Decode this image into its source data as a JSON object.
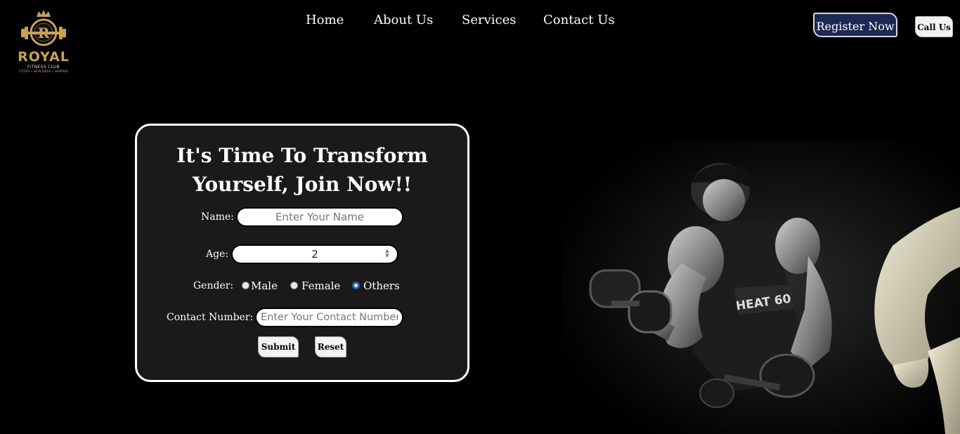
{
  "brand": {
    "name": "ROYAL",
    "subtitle": "FITNESS CLUB",
    "tagline": "FITTER • HEALTHIER • HAPPIER",
    "logo_icon": "crown-dumbbell-emblem",
    "gold_color": "#c9a24a"
  },
  "nav": {
    "items": [
      {
        "label": "Home"
      },
      {
        "label": "About Us"
      },
      {
        "label": "Services"
      },
      {
        "label": "Contact Us"
      }
    ],
    "register_label": "Register Now",
    "call_label": "Call Us",
    "register_color": "#1b2a55"
  },
  "form": {
    "title_line1": "It's Time To Transform",
    "title_line2": "Yourself, Join Now!!",
    "name": {
      "label": "Name:",
      "placeholder": "Enter Your Name",
      "value": ""
    },
    "age": {
      "label": "Age:",
      "value": "2"
    },
    "gender": {
      "label": "Gender:",
      "options": [
        "Male",
        "Female",
        "Others"
      ],
      "selected": "Others"
    },
    "contact": {
      "label": "Contact Number:",
      "placeholder": "Enter Your Contact Number",
      "value": ""
    },
    "submit_label": "Submit",
    "reset_label": "Reset"
  },
  "hero": {
    "image": "bodybuilder-lifting-dumbbells-photo",
    "shirt_text": "HEAT 60"
  }
}
